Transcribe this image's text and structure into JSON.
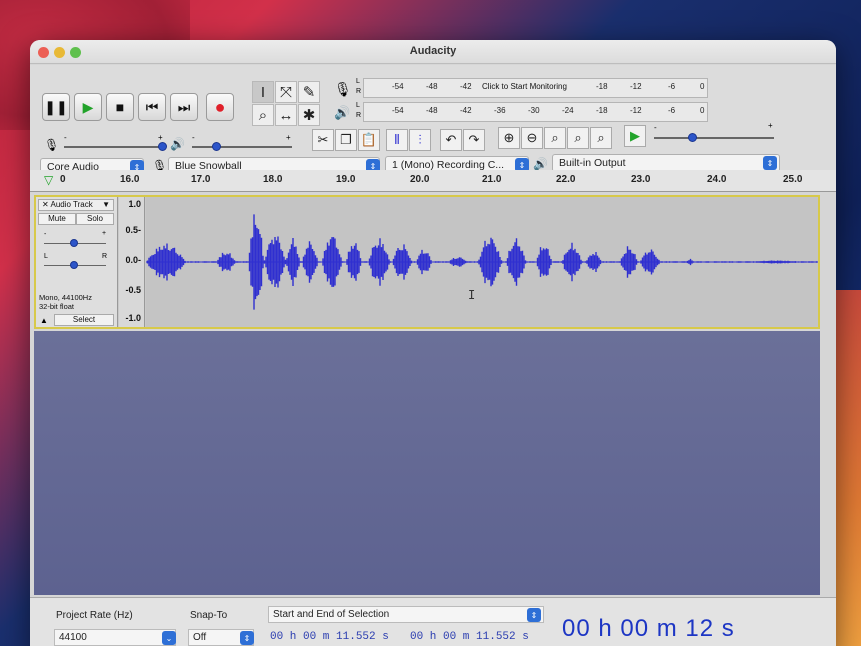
{
  "window": {
    "title": "Audacity"
  },
  "colors": {
    "waveform": "#2f2fd0",
    "selection_border": "#d7c94a",
    "accent": "#2e6fd6",
    "record": "#e0202a",
    "play": "#22a32a"
  },
  "transport": {
    "pause_icon": "pause-icon",
    "play_icon": "play-icon",
    "stop_icon": "stop-icon",
    "skip_start_icon": "skip-start-icon",
    "skip_end_icon": "skip-end-icon",
    "record_icon": "record-icon"
  },
  "meters": {
    "record_ticks": [
      "-54",
      "-48",
      "-42",
      "-18",
      "-12",
      "-6",
      "0"
    ],
    "monitor_text": "Click to Start Monitoring",
    "playback_ticks": [
      "-54",
      "-48",
      "-42",
      "-36",
      "-30",
      "-24",
      "-18",
      "-12",
      "-6",
      "0"
    ],
    "channel_l": "L",
    "channel_r": "R",
    "mixer_minus": "-",
    "mixer_plus": "+"
  },
  "devices": {
    "host": "Core Audio",
    "recording_device": "Blue Snowball",
    "recording_channels": "1 (Mono) Recording C...",
    "playback_device": "Built-in Output"
  },
  "ruler": {
    "labels": [
      "0",
      "16.0",
      "17.0",
      "18.0",
      "19.0",
      "20.0",
      "21.0",
      "22.0",
      "23.0",
      "24.0",
      "25.0"
    ]
  },
  "track": {
    "name": "Audio Track",
    "mute_label": "Mute",
    "solo_label": "Solo",
    "gain_minus": "-",
    "gain_plus": "+",
    "pan_left": "L",
    "pan_right": "R",
    "info_line1": "Mono, 44100Hz",
    "info_line2": "32-bit float",
    "select_label": "Select",
    "scale_labels": [
      "1.0",
      "0.5-",
      "0.0-",
      "-0.5",
      "-1.0"
    ]
  },
  "selection_toolbar": {
    "project_rate_label": "Project Rate (Hz)",
    "project_rate_value": "44100",
    "snap_to_label": "Snap-To",
    "snap_to_value": "Off",
    "selection_mode": "Start and End of Selection",
    "start_time": "00 h 00 m 11.552 s",
    "end_time": "00 h 00 m 11.552 s",
    "audio_position": "00 h 00 m 12 s"
  }
}
